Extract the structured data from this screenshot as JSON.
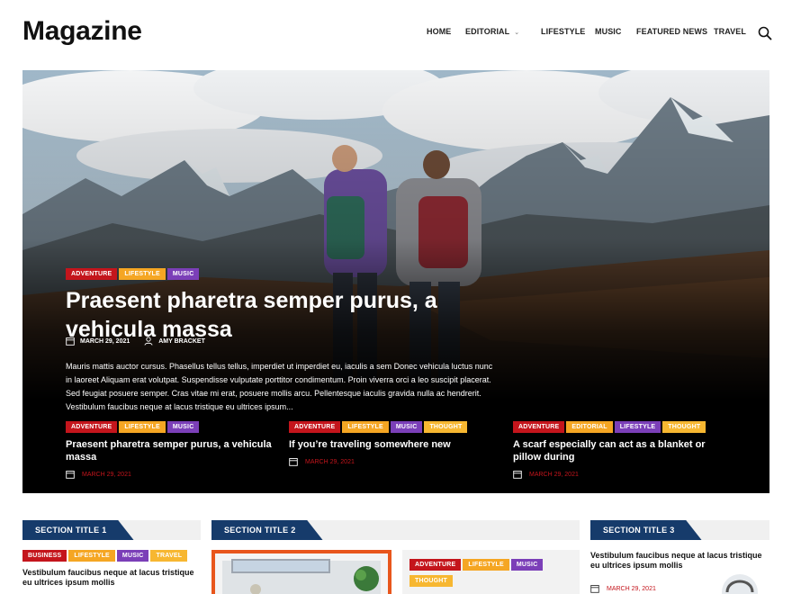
{
  "site": {
    "logo": "Magazine"
  },
  "nav": {
    "items": [
      {
        "label": "HOME"
      },
      {
        "label": "EDITORIAL",
        "has_dropdown": true
      },
      {
        "label": "LIFESTYLE"
      },
      {
        "label": "MUSIC"
      },
      {
        "label": "FEATURED NEWS"
      },
      {
        "label": "TRAVEL"
      }
    ],
    "search_icon": "search-icon"
  },
  "hero": {
    "tags": [
      "ADVENTURE",
      "LIFESTYLE",
      "MUSIC"
    ],
    "title": "Praesent pharetra semper purus, a vehicula massa",
    "date": "MARCH 29, 2021",
    "author": "AMY BRACKET",
    "excerpt": "Mauris mattis auctor cursus. Phasellus tellus tellus, imperdiet ut imperdiet eu, iaculis a sem Donec vehicula luctus nunc in laoreet Aliquam erat volutpat. Suspendisse vulputate porttitor condimentum. Proin viverra orci a leo suscipit placerat. Sed feugiat posuere semper. Cras vitae mi erat, posuere mollis arcu. Pellentesque iaculis gravida nulla ac hendrerit. Vestibulum faucibus neque at lacus tristique eu ultrices ipsum..."
  },
  "cards": [
    {
      "tags": [
        "ADVENTURE",
        "LIFESTYLE",
        "MUSIC"
      ],
      "title": "Praesent pharetra semper purus, a vehicula massa",
      "date": "MARCH 29, 2021"
    },
    {
      "tags": [
        "ADVENTURE",
        "LIFESTYLE",
        "MUSIC",
        "THOUGHT"
      ],
      "title": "If you’re traveling somewhere new",
      "date": "MARCH 29, 2021"
    },
    {
      "tags": [
        "ADVENTURE",
        "EDITORIAL",
        "LIFESTYLE",
        "THOUGHT"
      ],
      "title": "A scarf especially can act as a blanket or pillow during",
      "date": "MARCH 29, 2021"
    }
  ],
  "sections": [
    {
      "title": "SECTION TITLE 1",
      "tags": [
        "BUSINESS",
        "LIFESTYLE",
        "MUSIC",
        "TRAVEL"
      ],
      "text": "Vestibulum faucibus neque at lacus tristique eu ultrices ipsum mollis"
    },
    {
      "title": "SECTION TITLE 2",
      "tags": [
        "ADVENTURE",
        "LIFESTYLE",
        "MUSIC",
        "THOUGHT"
      ]
    },
    {
      "title": "SECTION TITLE 3",
      "text": "Vestibulum faucibus neque at lacus tristique eu ultrices ipsum mollis",
      "date": "MARCH 29, 2021"
    }
  ],
  "colors": {
    "adventure": "#c4151c",
    "lifestyle": "#f5a623",
    "music": "#7b3fb8",
    "thought": "#f7b731",
    "section_label": "#163b6b",
    "date": "#c4151c"
  }
}
